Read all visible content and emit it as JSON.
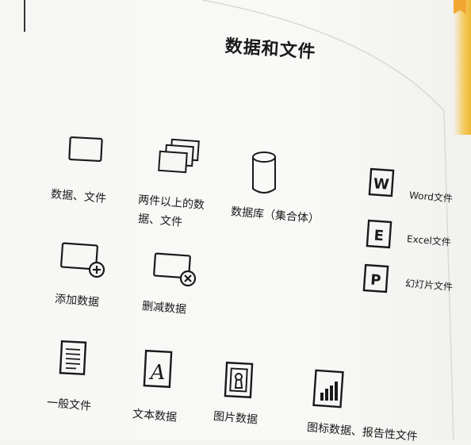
{
  "page": {
    "title": "数据和文件"
  },
  "icons": {
    "single_data": {
      "icon": "rectangle-icon",
      "label": "数据、文件"
    },
    "multi_data": {
      "icon": "stacked-rectangles-icon",
      "label_line1": "两件以上的数",
      "label_line2": "据、文件"
    },
    "database": {
      "icon": "cylinder-icon",
      "label": "数据库（集合体）"
    },
    "word": {
      "icon": "word-file-icon",
      "glyph": "W",
      "label": "Word文件"
    },
    "excel": {
      "icon": "excel-file-icon",
      "glyph": "E",
      "label": "Excel文件"
    },
    "ppt": {
      "icon": "slide-file-icon",
      "glyph": "P",
      "label": "幻灯片文件"
    },
    "add_data": {
      "icon": "add-data-icon",
      "label": "添加数据"
    },
    "delete_data": {
      "icon": "delete-data-icon",
      "label": "删减数据"
    },
    "general_file": {
      "icon": "document-lines-icon",
      "label": "一般文件"
    },
    "text_data": {
      "icon": "text-A-icon",
      "glyph": "A",
      "label": "文本数据"
    },
    "image_data": {
      "icon": "image-icon",
      "label": "图片数据"
    },
    "chart_report": {
      "icon": "bar-chart-file-icon",
      "label": "图标数据、报告性文件"
    }
  },
  "colors": {
    "ink": "#1a1a1a",
    "paper": "#f6f6f4",
    "accent_yellow": "#f2a732"
  }
}
